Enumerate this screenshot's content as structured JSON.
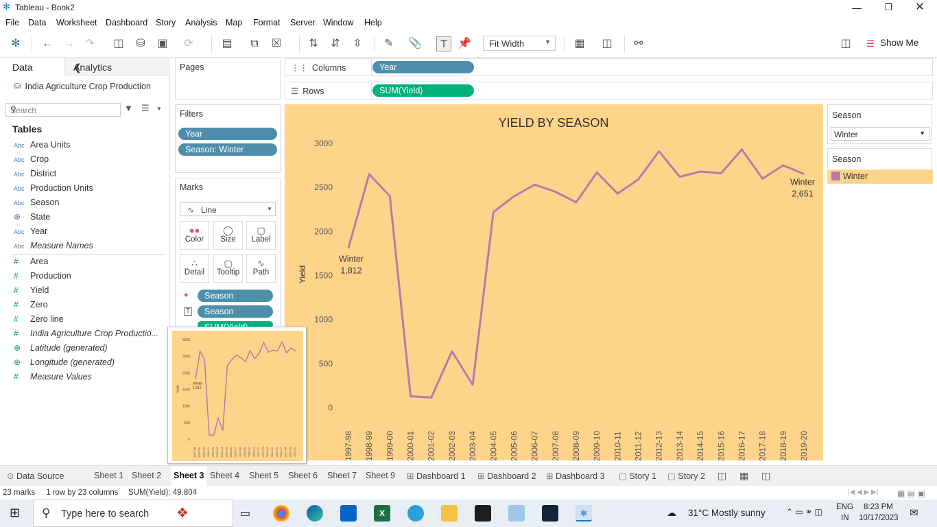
{
  "window": {
    "title": "Tableau - Book2"
  },
  "menu": [
    "File",
    "Data",
    "Worksheet",
    "Dashboard",
    "Story",
    "Analysis",
    "Map",
    "Format",
    "Server",
    "Window",
    "Help"
  ],
  "toolbar": {
    "fit": "Fit Width",
    "show_me": "Show Me"
  },
  "left": {
    "tab_data": "Data",
    "tab_analytics": "Analytics",
    "datasource": "India Agriculture Crop Production",
    "search_placeholder": "Search",
    "tables_heading": "Tables",
    "dimensions": [
      {
        "type": "Abc",
        "name": "Area Units"
      },
      {
        "type": "Abc",
        "name": "Crop"
      },
      {
        "type": "Abc",
        "name": "District"
      },
      {
        "type": "Abc",
        "name": "Production Units"
      },
      {
        "type": "Abc",
        "name": "Season"
      },
      {
        "type": "geo",
        "name": "State"
      },
      {
        "type": "Abc",
        "name": "Year"
      },
      {
        "type": "Abc",
        "name": "Measure Names"
      }
    ],
    "measures": [
      {
        "type": "#",
        "name": "Area"
      },
      {
        "type": "#",
        "name": "Production"
      },
      {
        "type": "#",
        "name": "Yield"
      },
      {
        "type": "#",
        "name": "Zero"
      },
      {
        "type": "#",
        "name": "Zero line"
      },
      {
        "type": "#",
        "name": "India Agriculture Crop Productio..."
      },
      {
        "type": "geo",
        "name": "Latitude (generated)"
      },
      {
        "type": "geo",
        "name": "Longitude (generated)"
      },
      {
        "type": "#",
        "name": "Measure Values"
      }
    ]
  },
  "pages": {
    "label": "Pages"
  },
  "filters": {
    "label": "Filters",
    "pills": [
      "Year",
      "Season: Winter"
    ]
  },
  "marks": {
    "label": "Marks",
    "type": "Line",
    "buttons": [
      "Color",
      "Size",
      "Label",
      "Detail",
      "Tooltip",
      "Path"
    ],
    "pills": [
      "Season",
      "Season",
      "SUM(Yield)"
    ]
  },
  "shelves": {
    "columns_label": "Columns",
    "columns_pill": "Year",
    "rows_label": "Rows",
    "rows_pill": "SUM(Yield)"
  },
  "right": {
    "filter_title": "Season",
    "filter_value": "Winter",
    "legend_title": "Season",
    "legend_item": "Winter",
    "legend_color": "#b77ba6"
  },
  "chart_data": {
    "type": "line",
    "title": "YIELD BY SEASON",
    "ylabel": "Yield",
    "xlabel": "",
    "ylim": [
      -100,
      3100
    ],
    "yticks": [
      0,
      500,
      1000,
      1500,
      2000,
      2500,
      3000
    ],
    "grid": false,
    "background": "#fed48b",
    "line_color": "#b77ba6",
    "categories": [
      "1997-98",
      "1998-99",
      "1999-00",
      "2000-01",
      "2001-02",
      "2002-03",
      "2003-04",
      "2004-05",
      "2005-06",
      "2006-07",
      "2007-08",
      "2008-09",
      "2009-10",
      "2010-11",
      "2011-12",
      "2012-13",
      "2013-14",
      "2014-15",
      "2015-16",
      "2016-17",
      "2017-18",
      "2018-19",
      "2019-20"
    ],
    "series": [
      {
        "name": "Winter",
        "values": [
          1812,
          2650,
          2400,
          130,
          115,
          640,
          260,
          2220,
          2400,
          2530,
          2450,
          2330,
          2670,
          2430,
          2590,
          2910,
          2620,
          2680,
          2660,
          2930,
          2600,
          2750,
          2651
        ]
      }
    ],
    "annotations": [
      {
        "label": "Winter",
        "value": "1,812",
        "index": 0
      },
      {
        "label": "Winter",
        "value": "2,651",
        "index": 22
      }
    ]
  },
  "preview": {
    "yticks": [
      "3000",
      "2500",
      "2000",
      "1500",
      "1000",
      "500",
      "0"
    ],
    "ylabel": "Yield",
    "label_name": "Winter",
    "label_value": "1,812"
  },
  "sheet_tabs": [
    "Data Source",
    "Sheet 1",
    "Sheet 2",
    "Sheet 3",
    "Sheet 4",
    "Sheet 5",
    "Sheet 6",
    "Sheet 7",
    "Sheet 9",
    "Dashboard 1",
    "Dashboard 2",
    "Dashboard 3",
    "Story 1",
    "Story 2"
  ],
  "active_sheet": "Sheet 3",
  "status": {
    "marks": "23 marks",
    "layout": "1 row by 23 columns",
    "sum": "SUM(Yield): 49,804"
  },
  "taskbar": {
    "search": "Type here to search",
    "weather": "31°C  Mostly sunny",
    "lang": "ENG",
    "region": "IN",
    "time": "8:23 PM",
    "date": "10/17/2023"
  }
}
